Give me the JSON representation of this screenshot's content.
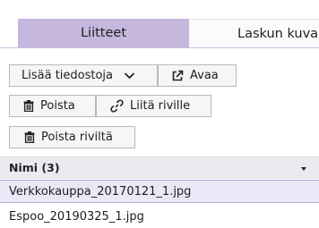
{
  "tabs": [
    {
      "label": "Liitteet",
      "active": true
    },
    {
      "label": "Laskun kuva",
      "active": false
    }
  ],
  "toolbar": {
    "add_files_label": "Lisää tiedostoja",
    "open_label": "Avaa",
    "delete_label": "Poista",
    "attach_row_label": "Liitä riville",
    "remove_from_row_label": "Poista riviltä"
  },
  "file_list": {
    "column_header": "Nimi (3)",
    "rows": [
      {
        "name": "Verkkokauppa_20170121_1.jpg",
        "selected": true
      },
      {
        "name": "Espoo_20190325_1.jpg",
        "selected": false
      }
    ]
  },
  "colors": {
    "tab_active": "#c6b7de",
    "selected_row": "#ece7f6",
    "button_background": "#f6f6f6"
  },
  "icons": [
    "chevron-down-icon",
    "open-external-icon",
    "trash-icon",
    "link-icon"
  ]
}
